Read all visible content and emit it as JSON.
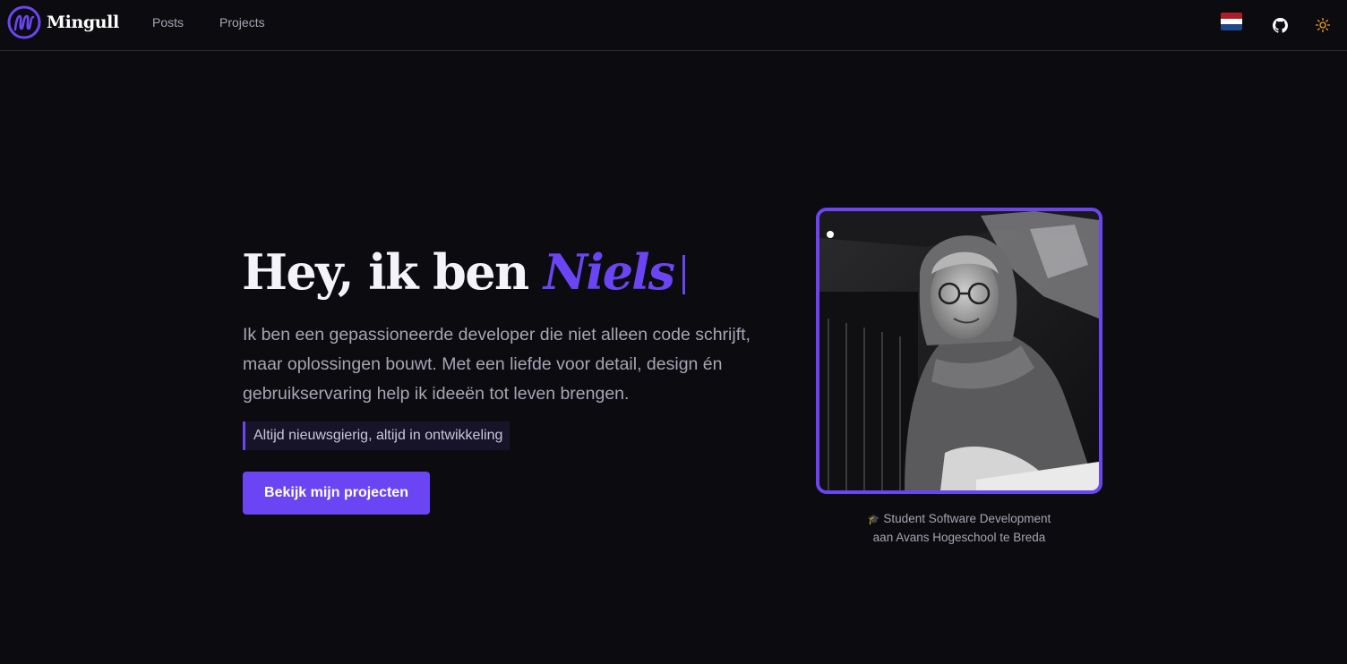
{
  "header": {
    "brand_name": "Mingull",
    "nav": [
      {
        "label": "Posts"
      },
      {
        "label": "Projects"
      }
    ],
    "language_flag_icon": "netherlands-flag-icon",
    "github_icon": "github-icon",
    "theme_icon": "sun-icon"
  },
  "hero": {
    "title_prefix": "Hey, ik ben ",
    "title_name": "Niels",
    "intro": "Ik ben een gepassioneerde developer die niet alleen code schrijft, maar oplossingen bouwt. Met een liefde voor detail, design én gebruikservaring help ik ideeën tot leven brengen.",
    "tagline": "Altijd nieuwsgierig, altijd in ontwikkeling",
    "cta_label": "Bekijk mijn projecten"
  },
  "profile": {
    "caption_line1": "Student Software Development",
    "caption_line2": "aan Avans Hogeschool te Breda",
    "caption_icon": "graduation-cap-icon"
  },
  "colors": {
    "background": "#0b0b10",
    "accent": "#6b45f3",
    "text_muted": "#a6a5b3",
    "sun_icon": "#f0a030"
  }
}
